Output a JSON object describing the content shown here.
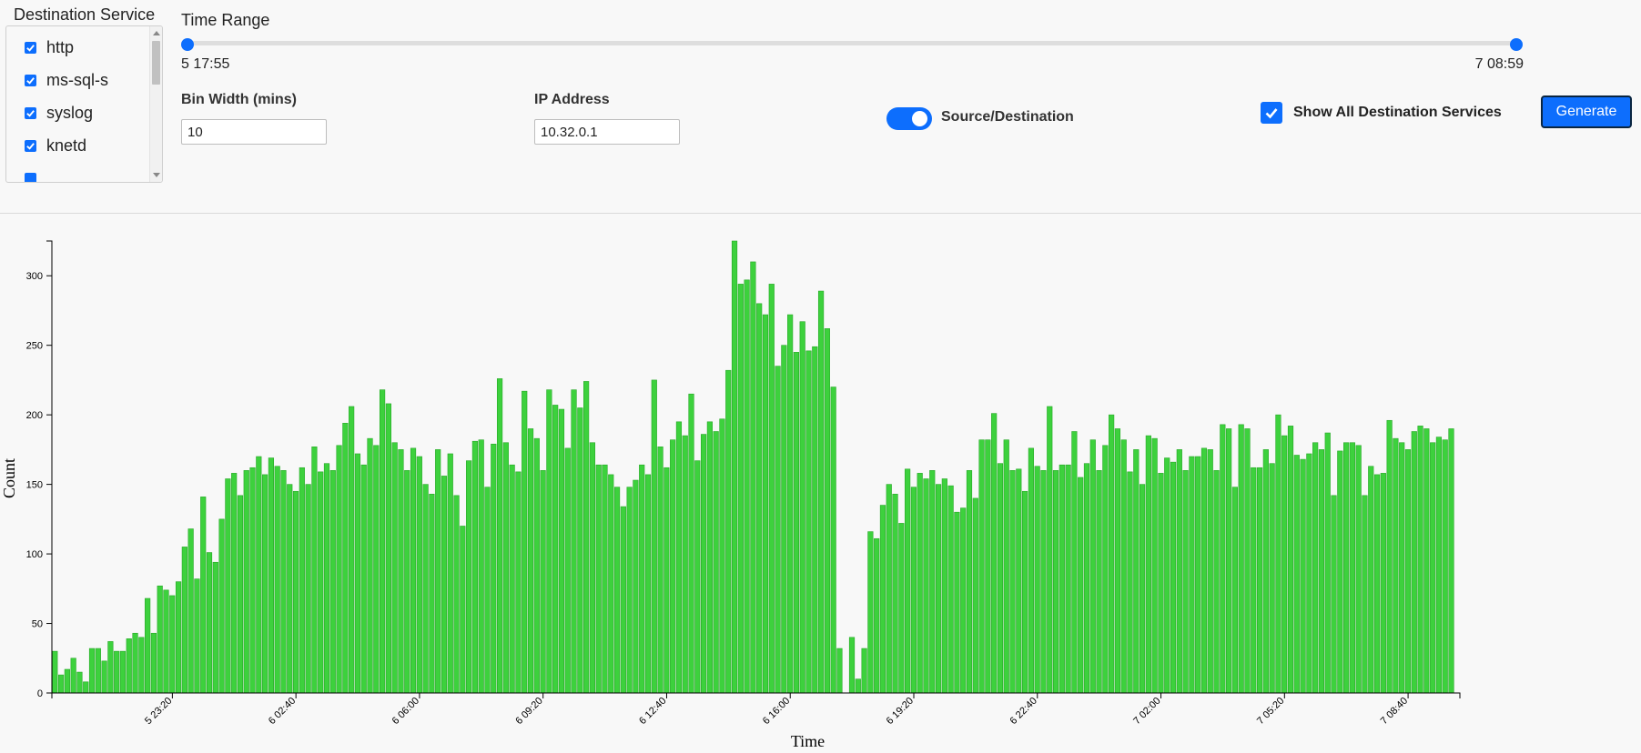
{
  "destination_service": {
    "title": "Destination Service",
    "items": [
      {
        "label": "http",
        "checked": true
      },
      {
        "label": "ms-sql-s",
        "checked": true
      },
      {
        "label": "syslog",
        "checked": true
      },
      {
        "label": "knetd",
        "checked": true
      }
    ]
  },
  "time_range": {
    "label": "Time Range",
    "min_label": "5 17:55",
    "max_label": "7 08:59"
  },
  "bin_width": {
    "label": "Bin Width (mins)",
    "value": "10"
  },
  "ip_address": {
    "label": "IP Address",
    "value": "10.32.0.1"
  },
  "source_destination": {
    "label": "Source/Destination",
    "on": true
  },
  "show_all": {
    "label": "Show All Destination Services",
    "checked": true
  },
  "generate": {
    "label": "Generate"
  },
  "colors": {
    "accent": "#0d6efd",
    "bar": "#3dd13d",
    "bar_stroke": "#27a827"
  },
  "chart_data": {
    "type": "bar",
    "xlabel": "Time",
    "ylabel": "Count",
    "ylim": [
      0,
      325
    ],
    "yticks": [
      0,
      50,
      100,
      150,
      200,
      250,
      300
    ],
    "x_tick_labels": [
      "5 23:20",
      "6 02:40",
      "6 06:00",
      "6 09:20",
      "6 12:40",
      "6 16:00",
      "6 19:20",
      "6 22:40",
      "7 02:00",
      "7 05:20",
      "7 08:40"
    ],
    "x_tick_bins": [
      19,
      39,
      59,
      79,
      99,
      119,
      139,
      159,
      179,
      199,
      219
    ],
    "values": [
      30,
      13,
      17,
      25,
      15,
      8,
      32,
      32,
      23,
      37,
      30,
      30,
      39,
      43,
      40,
      68,
      43,
      77,
      74,
      70,
      80,
      105,
      118,
      82,
      141,
      101,
      94,
      125,
      154,
      158,
      142,
      160,
      162,
      170,
      157,
      169,
      163,
      160,
      150,
      145,
      162,
      150,
      177,
      159,
      165,
      160,
      178,
      194,
      206,
      172,
      164,
      183,
      178,
      218,
      208,
      180,
      175,
      160,
      176,
      170,
      150,
      143,
      175,
      156,
      172,
      142,
      120,
      167,
      181,
      182,
      148,
      179,
      226,
      180,
      164,
      159,
      217,
      190,
      183,
      160,
      218,
      207,
      204,
      176,
      218,
      205,
      224,
      180,
      164,
      164,
      157,
      148,
      134,
      148,
      153,
      164,
      157,
      225,
      177,
      162,
      182,
      195,
      185,
      215,
      167,
      186,
      195,
      188,
      197,
      232,
      325,
      294,
      297,
      310,
      280,
      272,
      294,
      235,
      250,
      272,
      245,
      267,
      246,
      249,
      289,
      262,
      220,
      32,
      0,
      40,
      10,
      32,
      116,
      111,
      135,
      150,
      143,
      122,
      161,
      148,
      158,
      154,
      160,
      150,
      154,
      149,
      130,
      133,
      160,
      140,
      182,
      182,
      201,
      165,
      182,
      160,
      161,
      145,
      176,
      163,
      160,
      206,
      160,
      164,
      164,
      188,
      155,
      165,
      182,
      160,
      178,
      200,
      190,
      182,
      159,
      175,
      150,
      185,
      183,
      158,
      169,
      166,
      175,
      160,
      170,
      170,
      176,
      175,
      160,
      193,
      190,
      148,
      193,
      190,
      162,
      162,
      175,
      165,
      200,
      185,
      192,
      171,
      168,
      172,
      180,
      175,
      187,
      142,
      174,
      180,
      180,
      178,
      142,
      163,
      157,
      158,
      196,
      183,
      180,
      175,
      188,
      192,
      190,
      180,
      184,
      182,
      190
    ]
  }
}
